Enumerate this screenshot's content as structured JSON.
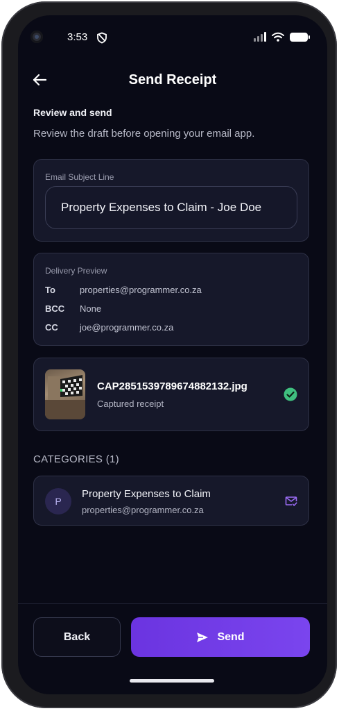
{
  "status_bar": {
    "time": "3:53"
  },
  "header": {
    "title": "Send Receipt"
  },
  "intro": {
    "heading": "Review and send",
    "subtitle": "Review the draft before opening your email app."
  },
  "subject": {
    "label": "Email Subject Line",
    "value": "Property Expenses to Claim - Joe Doe"
  },
  "delivery": {
    "label": "Delivery Preview",
    "rows": [
      {
        "key": "To",
        "value": "properties@programmer.co.za"
      },
      {
        "key": "BCC",
        "value": "None"
      },
      {
        "key": "CC",
        "value": "joe@programmer.co.za"
      }
    ]
  },
  "attachment": {
    "file_name": "CAP2851539789674882132.jpg",
    "subtitle": "Captured receipt",
    "status_color": "#3fbf7f"
  },
  "categories": {
    "heading": "CATEGORIES (1)",
    "items": [
      {
        "initial": "P",
        "name": "Property Expenses to Claim",
        "email": "properties@programmer.co.za"
      }
    ]
  },
  "actions": {
    "back_label": "Back",
    "send_label": "Send",
    "accent": "#7040e8"
  },
  "icons": {
    "back": "arrow-left-icon",
    "status": "shield-icon",
    "attachment_status": "check-circle-icon",
    "category_action": "mail-check-icon",
    "send": "send-icon"
  }
}
